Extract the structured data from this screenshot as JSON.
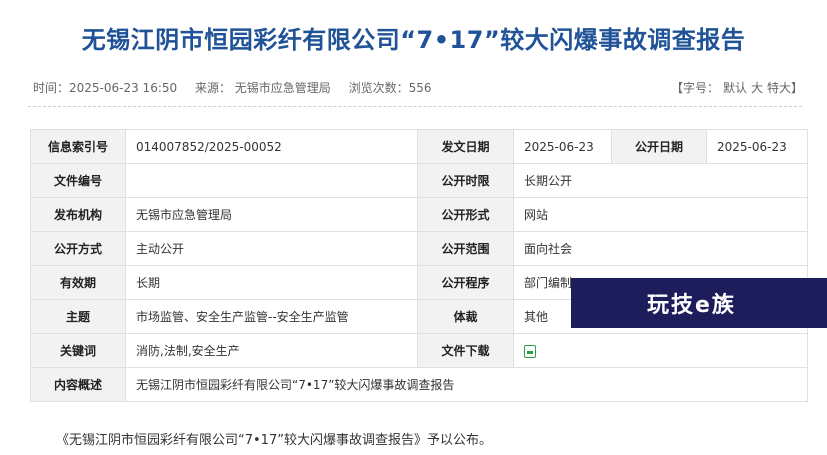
{
  "article": {
    "title": "无锡江阴市恒园彩纤有限公司“7•17”较大闪爆事故调查报告",
    "time": "时间：2025-06-23 16:50",
    "source": "来源：  无锡市应急管理局",
    "views": "浏览次数：556",
    "font_size": {
      "label": "【字号：",
      "default": "默认",
      "large": "大",
      "xlarge": "特大】"
    }
  },
  "info_table": {
    "index_label": "信息索引号",
    "index_value": "014007852/2025-00052",
    "issue_date_label": "发文日期",
    "issue_date_value": "2025-06-23",
    "public_date_label": "公开日期",
    "public_date_value": "2025-06-23",
    "doc_number_label": "文件编号",
    "doc_number_value": "",
    "public_period_label": "公开时限",
    "public_period_value": "长期公开",
    "agency_label": "发布机构",
    "agency_value": "无锡市应急管理局",
    "public_form_label": "公开形式",
    "public_form_value": "网站",
    "public_method_label": "公开方式",
    "public_method_value": "主动公开",
    "public_scope_label": "公开范围",
    "public_scope_value": "面向社会",
    "validity_label": "有效期",
    "validity_value": "长期",
    "procedure_label": "公开程序",
    "procedure_value": "部门编制",
    "topic_label": "主题",
    "topic_value": "市场监管、安全生产监管--安全生产监管",
    "genre_label": "体裁",
    "genre_value": "其他",
    "keywords_label": "关键词",
    "keywords_value": "消防,法制,安全生产",
    "download_label": "文件下载",
    "summary_label": "内容概述",
    "summary_value": "无锡江阴市恒园彩纤有限公司“7•17”较大闪爆事故调查报告"
  },
  "body_text": "《无锡江阴市恒园彩纤有限公司“7•17”较大闪爆事故调查报告》予以公布。",
  "watermark": {
    "text": "玩技e族"
  },
  "colors": {
    "title": "#1f5297",
    "header_bg": "#f2f2f2",
    "watermark_bg": "#1e1d5c"
  }
}
